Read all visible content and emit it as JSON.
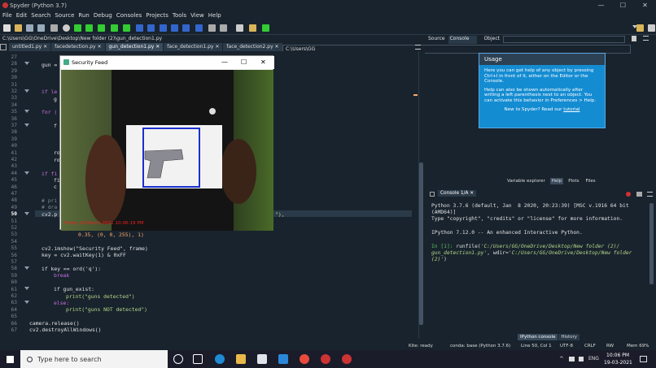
{
  "window": {
    "title": "Spyder (Python 3.7)",
    "min": "—",
    "max": "☐",
    "close": "✕"
  },
  "menu": [
    "File",
    "Edit",
    "Search",
    "Source",
    "Run",
    "Debug",
    "Consoles",
    "Projects",
    "Tools",
    "View",
    "Help"
  ],
  "toolbar": {
    "path": "C:\\Users\\GG"
  },
  "editor": {
    "file_path": "C:\\Users\\GG\\OneDrive\\Desktop\\New folder (2)\\gun_detection1.py",
    "tabs": [
      {
        "label": "untitled1.py ✕"
      },
      {
        "label": "facedetection.py ✕"
      },
      {
        "label": "gun_detection1.py ✕"
      },
      {
        "label": "face_detection1.py ✕"
      },
      {
        "label": "face_detection2.py ✕"
      }
    ],
    "line_numbers": [
      "27",
      "28",
      "29",
      "30",
      "31",
      "32",
      "33",
      "34",
      "35",
      "36",
      "37",
      "38",
      "39",
      "40",
      "41",
      "42",
      "43",
      "44",
      "45",
      "46",
      "47",
      "48",
      "49",
      "50",
      "51",
      "52",
      "53",
      "54",
      "55",
      "56",
      "57",
      "58",
      "59",
      "60",
      "61",
      "62",
      "63",
      "64",
      "65",
      "66",
      "67"
    ],
    "current_line": "50",
    "code": {
      "l28": "gun =",
      "l32": "if le",
      "l33": "g",
      "l35": "for (",
      "l37": "f",
      "l41": "ro",
      "l42": "ro",
      "l44": "if fi",
      "l45": "fi",
      "l46": "c",
      "l48": "# pri",
      "l49": "# dra",
      "l50a": "cv2.p",
      "l50b": "\"),",
      "l53": "0.35, (0, 0, 255), 1)",
      "l55": "cv2.imshow(\"Security Feed\", frame)",
      "l56": "key = cv2.waitKey(1) & 0xFF",
      "l58": "if key == ord('q'):",
      "l59": "break",
      "l61": "if gun_exist:",
      "l62": "print(\"guns detected\")",
      "l63": "else:",
      "l64": "print(\"guns NOT detected\")",
      "l66": "camera.release()",
      "l67": "cv2.destroyAllWindows()"
    }
  },
  "feed_window": {
    "title": "Security Feed",
    "timestamp": "Friday 19 March 2021 10:06:19 PM"
  },
  "right_pane": {
    "tabs": [
      "Source",
      "Console",
      "Object"
    ],
    "usage": {
      "title": "Usage",
      "p1": "Here you can get help of any object by pressing Ctrl+I in front of it, either on the Editor or the Console.",
      "p2": "Help can also be shown automatically after writing a left parenthesis next to an object. You can activate this behavior in Preferences > Help.",
      "p3a": "New to Spyder? Read our ",
      "p3b": "tutorial"
    },
    "pane_tabs": [
      "Variable explorer",
      "Help",
      "Plots",
      "Files"
    ]
  },
  "console": {
    "tab": "Console 1/A ✕",
    "lines": [
      "Python 3.7.6 (default, Jan  8 2020, 20:23:39) [MSC v.1916 64 bit",
      "(AMD64)]",
      "Type \"copyright\", \"credits\" or \"license\" for more information.",
      "",
      "IPython 7.12.0 -- An enhanced Interactive Python."
    ],
    "in_prompt": "In [1]: ",
    "in_code1": "runfile(",
    "in_str1": "'C:/Users/GG/OneDrive/Desktop/New folder (2)/",
    "in_str2": "gun_detection1.py'",
    "in_code2": ", wdir=",
    "in_str3": "'C:/Users/GG/OneDrive/Desktop/New folder",
    "in_str4": "(2)'",
    "in_close": ")",
    "bottom_tabs": [
      "IPython console",
      "History"
    ]
  },
  "status": {
    "kite": "Kite: ready",
    "conda": "conda: base (Python 3.7.6)",
    "pos": "Line 50, Col 1",
    "enc": "UTF-8",
    "eol": "CRLF",
    "rw": "RW",
    "mem": "Mem 69%"
  },
  "taskbar": {
    "search_placeholder": "Type here to search",
    "lang": "ENG",
    "time": "10:06 PM",
    "date": "19-03-2021"
  },
  "colors": {
    "accent": "#148cd2",
    "bg": "#19232d",
    "red_text": "#e82020"
  }
}
